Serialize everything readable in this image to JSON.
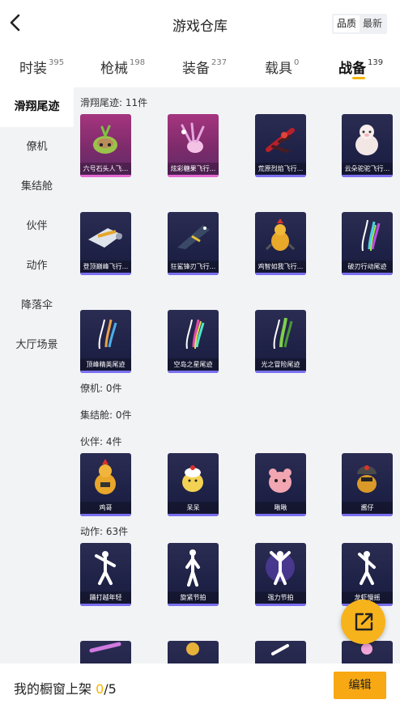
{
  "header": {
    "title": "游戏仓库",
    "sort": [
      "品质",
      "最新"
    ]
  },
  "tabs": [
    {
      "label": "时装",
      "count": "395"
    },
    {
      "label": "枪械",
      "count": "198"
    },
    {
      "label": "装备",
      "count": "237"
    },
    {
      "label": "载具",
      "count": "0"
    },
    {
      "label": "战备",
      "count": "139",
      "active": true
    }
  ],
  "sidebar": {
    "items": [
      "滑翔尾迹",
      "僚机",
      "集结舱",
      "伙伴",
      "动作",
      "降落伞",
      "大厅场景"
    ]
  },
  "sections": {
    "trail": {
      "title": "滑翔尾迹: 11件",
      "items": [
        "六号石头人飞...",
        "炫彩糖果飞行...",
        "荒原烈焰飞行...",
        "云朵驼驼飞行...",
        "登顶巅峰飞行...",
        "狂鲨锋刃飞行...",
        "鸡智如我飞行...",
        "破刃行动尾迹",
        "顶峰精英尾迹",
        "空岛之星尾迹",
        "光之冒险尾迹"
      ]
    },
    "wingman": {
      "title": "僚机: 0件"
    },
    "pod": {
      "title": "集结舱: 0件"
    },
    "partner": {
      "title": "伙伴: 4件",
      "items": [
        "鸡哥",
        "呆呆",
        "啾啾",
        "酱仔"
      ]
    },
    "action": {
      "title": "动作: 63件",
      "items": [
        "踊打越年轻",
        "旋紧节拍",
        "强力节拍",
        "龙虾慢摇"
      ]
    }
  },
  "icons": {
    "back": "chevron-left-icon",
    "share": "share-external-icon"
  },
  "bottom": {
    "prefix": "我的橱窗上架 ",
    "current": "0",
    "total": "/5",
    "edit": "编辑"
  },
  "colors": {
    "accent": "#f5b400",
    "button": "#f7a813",
    "fab": "#f7b31b"
  }
}
